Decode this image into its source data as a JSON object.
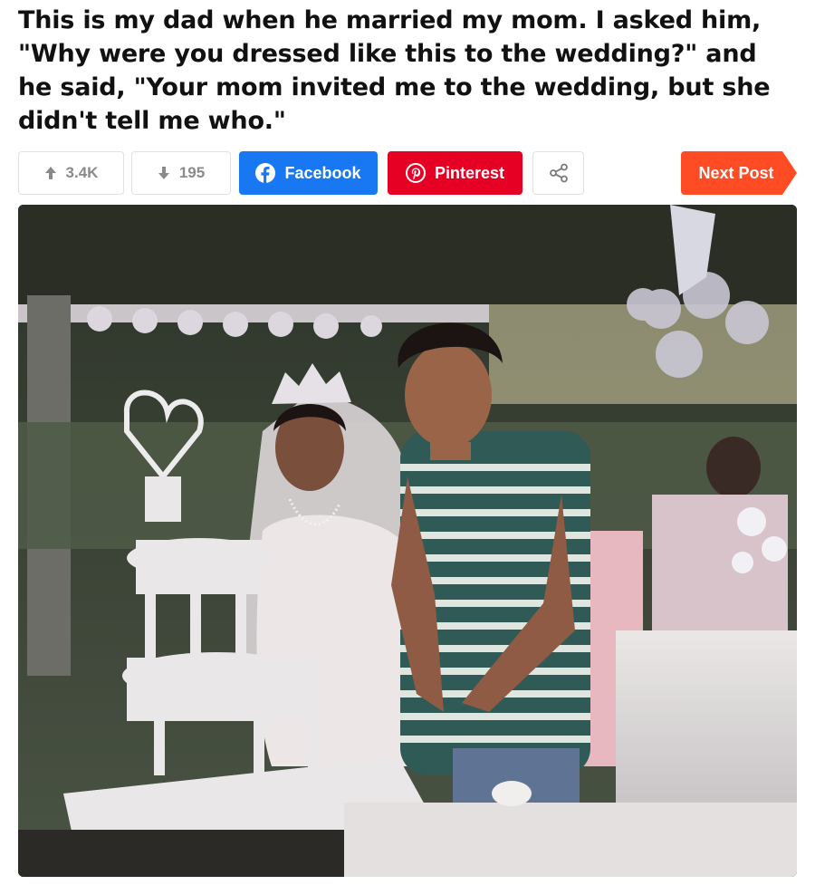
{
  "post": {
    "title": "This is my dad when he married my mom. I asked him, \"Why were you dressed like this to the wedding?\" and he said, \"Your mom invited me to the wedding, but she didn't tell me who.\""
  },
  "actions": {
    "upvotes": "3.4K",
    "downvotes": "195",
    "facebook_label": "Facebook",
    "pinterest_label": "Pinterest",
    "next_post_label": "Next Post"
  },
  "colors": {
    "facebook": "#1877f2",
    "pinterest": "#e60023",
    "next_post": "#ff4c24",
    "vote_text": "#8a8a8a"
  },
  "icons": {
    "upvote": "arrow-up-icon",
    "downvote": "arrow-down-icon",
    "facebook": "facebook-icon",
    "pinterest": "pinterest-icon",
    "share": "share-icon"
  }
}
